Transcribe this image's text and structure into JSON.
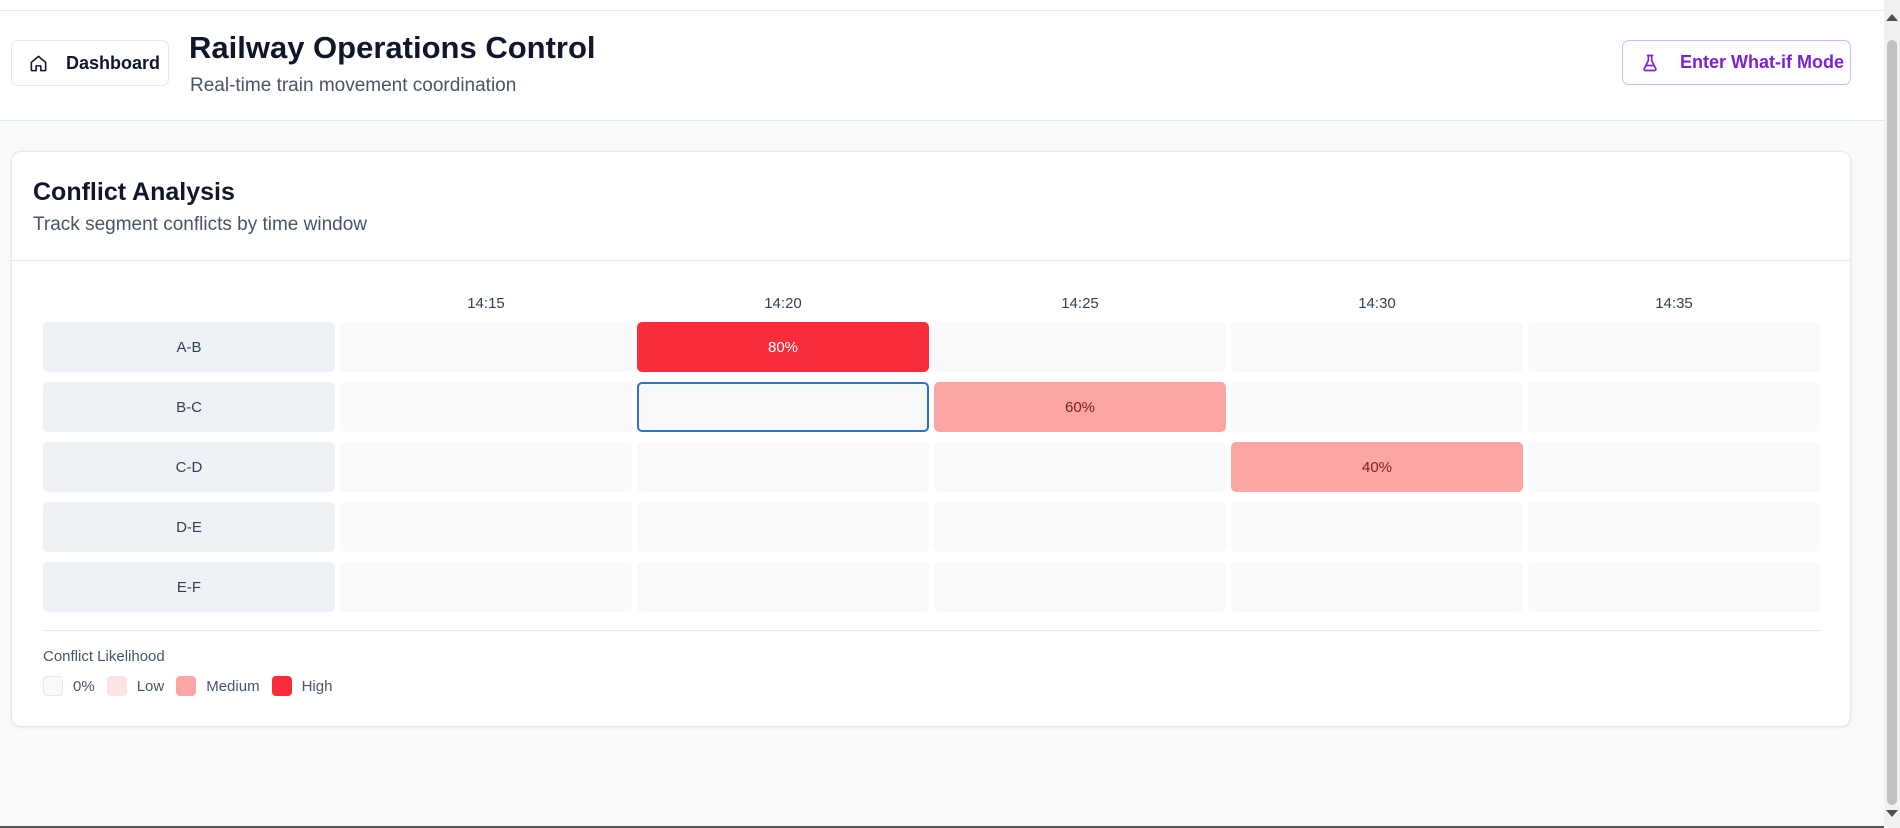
{
  "header": {
    "dashboard_label": "Dashboard",
    "dashboard_icon": "home-icon",
    "title": "Railway Operations Control",
    "subtitle": "Real-time train movement coordination",
    "whatif_label": "Enter What-if Mode",
    "whatif_icon": "flask-icon"
  },
  "card": {
    "title": "Conflict Analysis",
    "description": "Track segment conflicts by time window"
  },
  "heatmap": {
    "time_windows": [
      "14:15",
      "14:20",
      "14:25",
      "14:30",
      "14:35"
    ],
    "segments": [
      "A-B",
      "B-C",
      "C-D",
      "D-E",
      "E-F"
    ],
    "conflicts": [
      {
        "segment": "A-B",
        "window": "14:20",
        "likelihood": 80,
        "label": "80%",
        "level": "high"
      },
      {
        "segment": "B-C",
        "window": "14:25",
        "likelihood": 60,
        "label": "60%",
        "level": "medium"
      },
      {
        "segment": "C-D",
        "window": "14:30",
        "likelihood": 40,
        "label": "40%",
        "level": "medium"
      }
    ],
    "selected_cell": {
      "segment": "B-C",
      "window": "14:20"
    }
  },
  "legend": {
    "title": "Conflict Likelihood",
    "items": [
      {
        "label": "0%",
        "color": "#f8f9fb"
      },
      {
        "label": "Low",
        "color": "#fde2e2"
      },
      {
        "label": "Medium",
        "color": "#fca5a5"
      },
      {
        "label": "High",
        "color": "#fb2c3a"
      }
    ]
  },
  "colors": {
    "high": "#fb2c3a",
    "medium": "#fca5a5",
    "empty": "#f8f9fb",
    "accent_purple": "#7e22ce",
    "selection": "#2f6fd1"
  }
}
